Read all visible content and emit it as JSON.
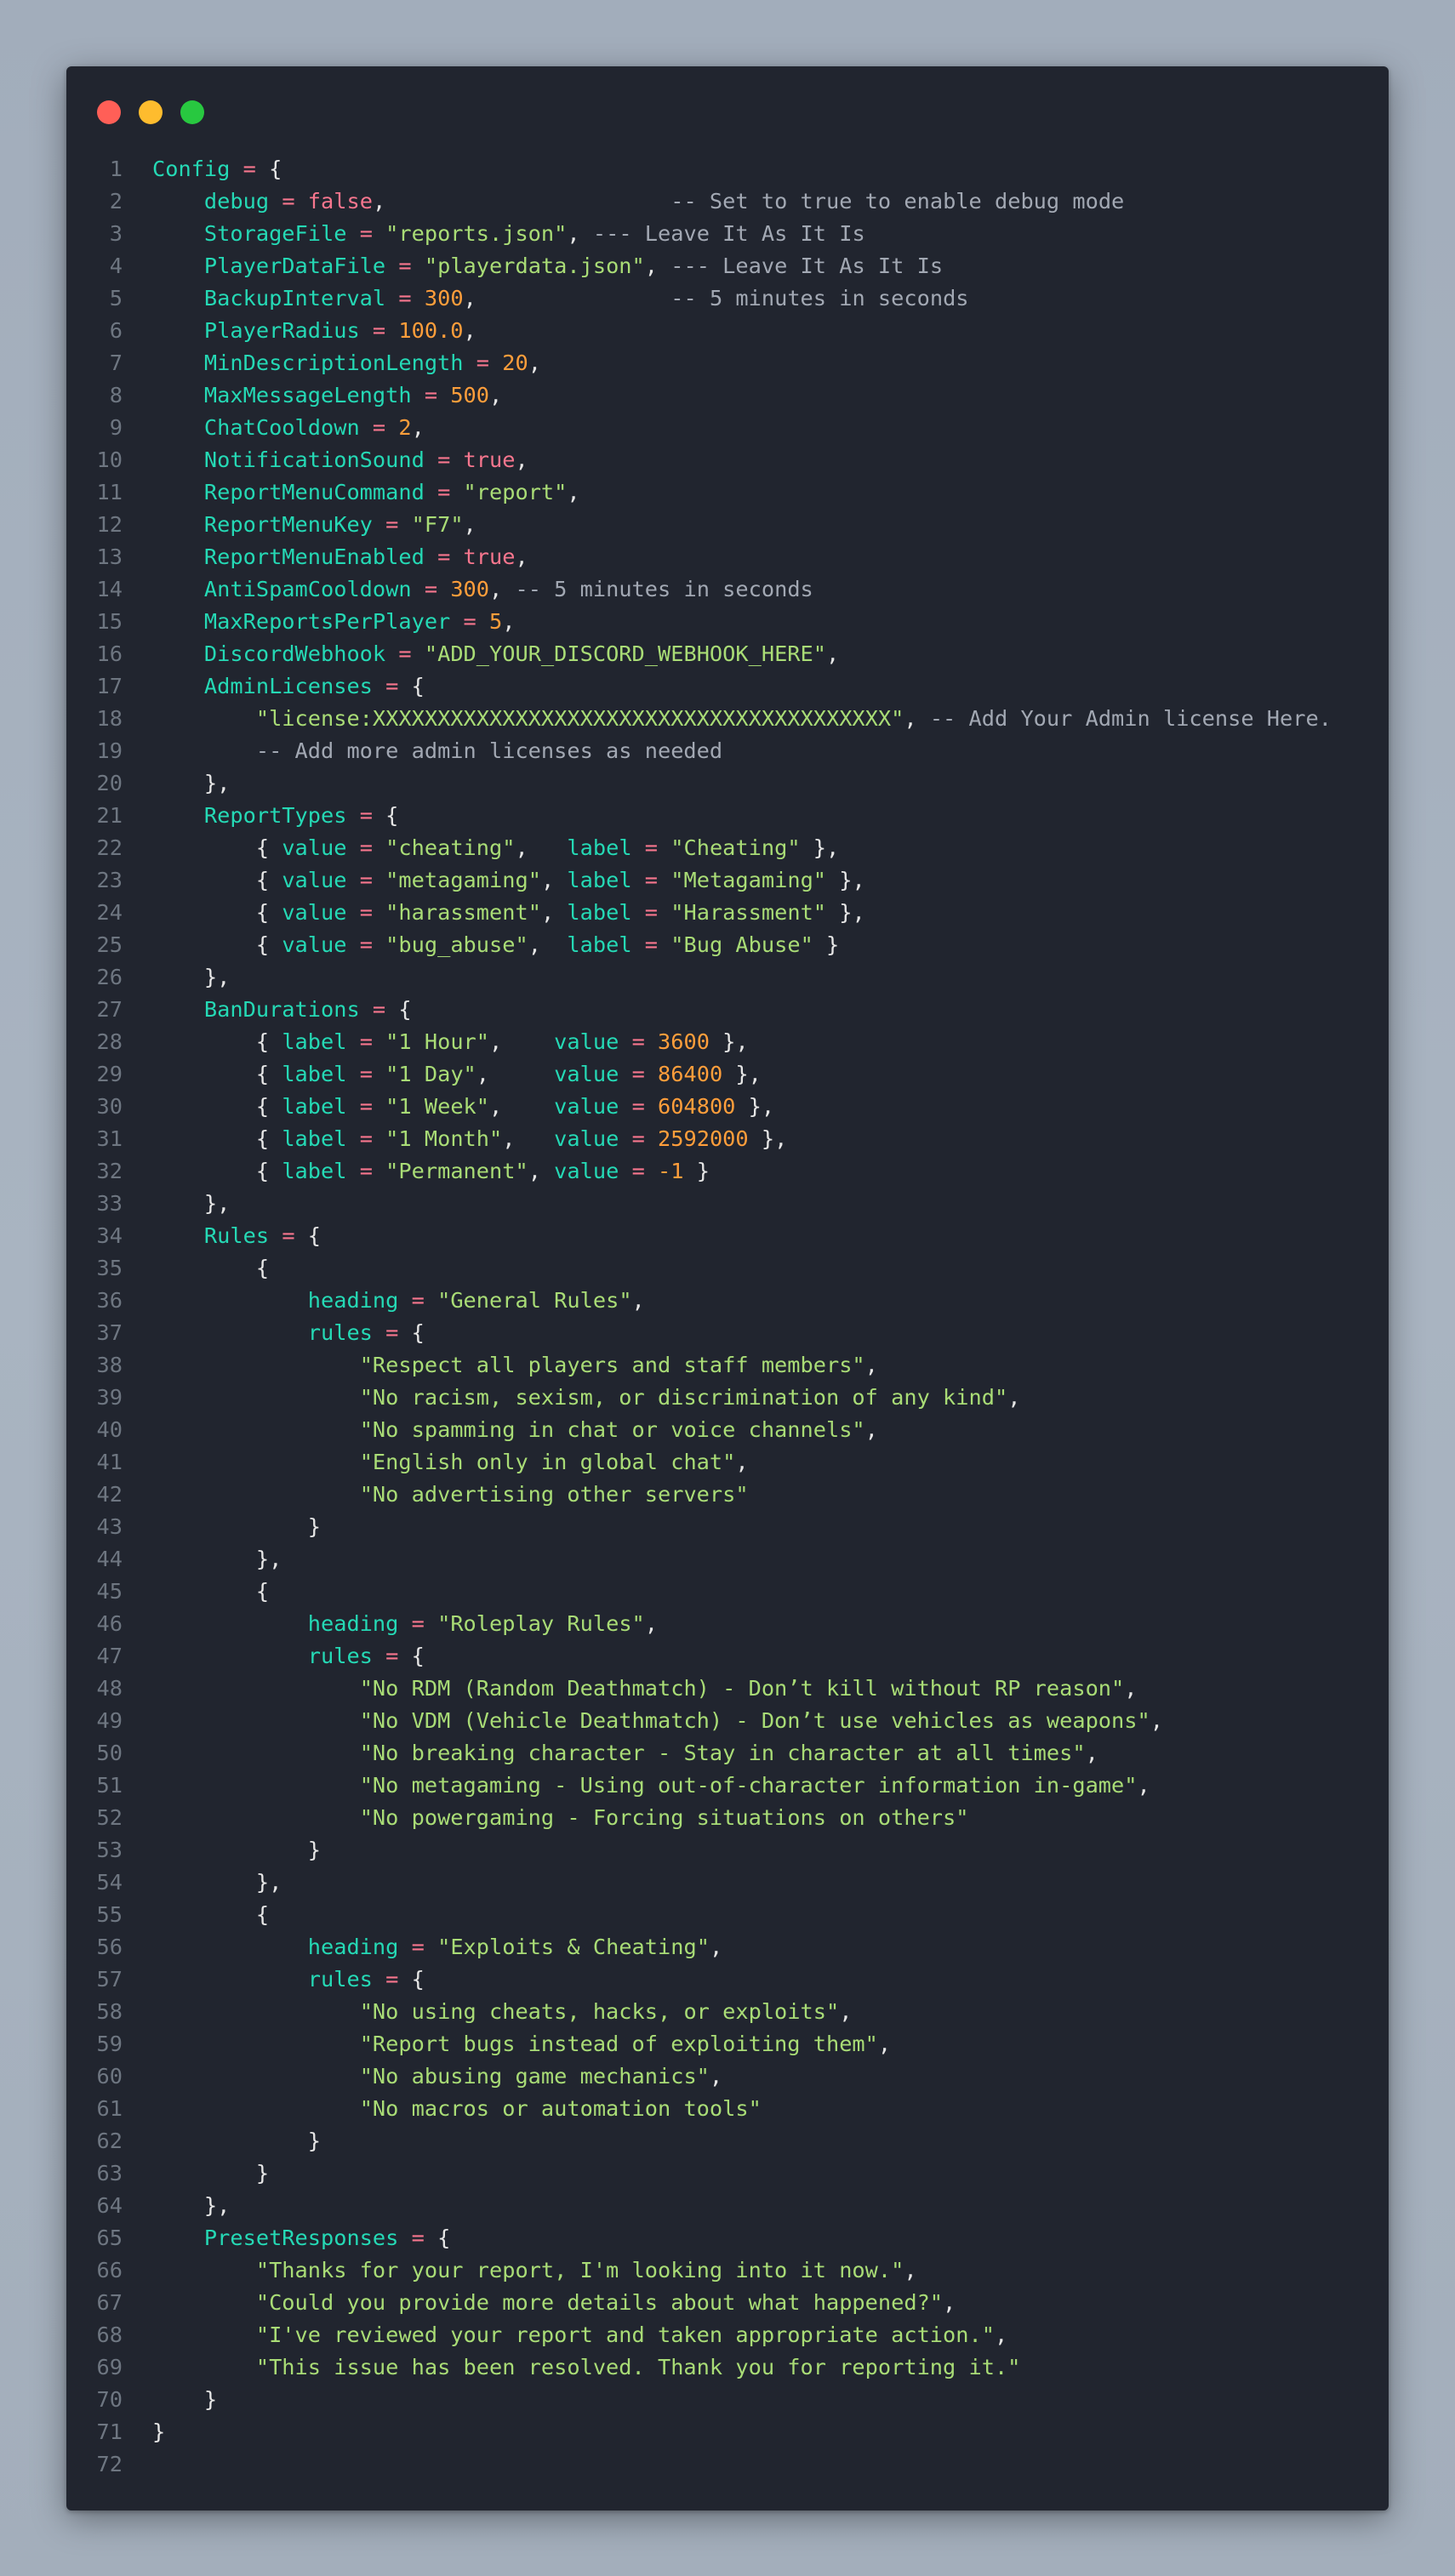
{
  "window": {
    "buttons": [
      "close",
      "minimize",
      "maximize"
    ]
  },
  "colors": {
    "identifier": "#25d9b5",
    "operator": "#f7768e",
    "boolean": "#f7768e",
    "string": "#a9dc76",
    "number": "#ff9e3b",
    "comment": "#a2a8b3",
    "punctuation": "#e6e6e6",
    "line_number": "#6e7681",
    "editor_background": "#21252f"
  },
  "code_lines": [
    [
      [
        "id",
        "Config"
      ],
      [
        "p",
        " "
      ],
      [
        "op",
        "="
      ],
      [
        "p",
        " {"
      ]
    ],
    [
      [
        "p",
        "    "
      ],
      [
        "id",
        "debug"
      ],
      [
        "p",
        " "
      ],
      [
        "op",
        "="
      ],
      [
        "p",
        " "
      ],
      [
        "bool",
        "false"
      ],
      [
        "p",
        ",                      "
      ],
      [
        "com",
        "-- Set to true to enable debug mode"
      ]
    ],
    [
      [
        "p",
        "    "
      ],
      [
        "id",
        "StorageFile"
      ],
      [
        "p",
        " "
      ],
      [
        "op",
        "="
      ],
      [
        "p",
        " "
      ],
      [
        "str",
        "\"reports.json\""
      ],
      [
        "p",
        ", "
      ],
      [
        "com",
        "--- Leave It As It Is"
      ]
    ],
    [
      [
        "p",
        "    "
      ],
      [
        "id",
        "PlayerDataFile"
      ],
      [
        "p",
        " "
      ],
      [
        "op",
        "="
      ],
      [
        "p",
        " "
      ],
      [
        "str",
        "\"playerdata.json\""
      ],
      [
        "p",
        ", "
      ],
      [
        "com",
        "--- Leave It As It Is"
      ]
    ],
    [
      [
        "p",
        "    "
      ],
      [
        "id",
        "BackupInterval"
      ],
      [
        "p",
        " "
      ],
      [
        "op",
        "="
      ],
      [
        "p",
        " "
      ],
      [
        "num",
        "300"
      ],
      [
        "p",
        ",               "
      ],
      [
        "com",
        "-- 5 minutes in seconds"
      ]
    ],
    [
      [
        "p",
        "    "
      ],
      [
        "id",
        "PlayerRadius"
      ],
      [
        "p",
        " "
      ],
      [
        "op",
        "="
      ],
      [
        "p",
        " "
      ],
      [
        "num",
        "100.0"
      ],
      [
        "p",
        ","
      ]
    ],
    [
      [
        "p",
        "    "
      ],
      [
        "id",
        "MinDescriptionLength"
      ],
      [
        "p",
        " "
      ],
      [
        "op",
        "="
      ],
      [
        "p",
        " "
      ],
      [
        "num",
        "20"
      ],
      [
        "p",
        ","
      ]
    ],
    [
      [
        "p",
        "    "
      ],
      [
        "id",
        "MaxMessageLength"
      ],
      [
        "p",
        " "
      ],
      [
        "op",
        "="
      ],
      [
        "p",
        " "
      ],
      [
        "num",
        "500"
      ],
      [
        "p",
        ","
      ]
    ],
    [
      [
        "p",
        "    "
      ],
      [
        "id",
        "ChatCooldown"
      ],
      [
        "p",
        " "
      ],
      [
        "op",
        "="
      ],
      [
        "p",
        " "
      ],
      [
        "num",
        "2"
      ],
      [
        "p",
        ","
      ]
    ],
    [
      [
        "p",
        "    "
      ],
      [
        "id",
        "NotificationSound"
      ],
      [
        "p",
        " "
      ],
      [
        "op",
        "="
      ],
      [
        "p",
        " "
      ],
      [
        "bool",
        "true"
      ],
      [
        "p",
        ","
      ]
    ],
    [
      [
        "p",
        "    "
      ],
      [
        "id",
        "ReportMenuCommand"
      ],
      [
        "p",
        " "
      ],
      [
        "op",
        "="
      ],
      [
        "p",
        " "
      ],
      [
        "str",
        "\"report\""
      ],
      [
        "p",
        ","
      ]
    ],
    [
      [
        "p",
        "    "
      ],
      [
        "id",
        "ReportMenuKey"
      ],
      [
        "p",
        " "
      ],
      [
        "op",
        "="
      ],
      [
        "p",
        " "
      ],
      [
        "str",
        "\"F7\""
      ],
      [
        "p",
        ","
      ]
    ],
    [
      [
        "p",
        "    "
      ],
      [
        "id",
        "ReportMenuEnabled"
      ],
      [
        "p",
        " "
      ],
      [
        "op",
        "="
      ],
      [
        "p",
        " "
      ],
      [
        "bool",
        "true"
      ],
      [
        "p",
        ","
      ]
    ],
    [
      [
        "p",
        "    "
      ],
      [
        "id",
        "AntiSpamCooldown"
      ],
      [
        "p",
        " "
      ],
      [
        "op",
        "="
      ],
      [
        "p",
        " "
      ],
      [
        "num",
        "300"
      ],
      [
        "p",
        ", "
      ],
      [
        "com",
        "-- 5 minutes in seconds"
      ]
    ],
    [
      [
        "p",
        "    "
      ],
      [
        "id",
        "MaxReportsPerPlayer"
      ],
      [
        "p",
        " "
      ],
      [
        "op",
        "="
      ],
      [
        "p",
        " "
      ],
      [
        "num",
        "5"
      ],
      [
        "p",
        ","
      ]
    ],
    [
      [
        "p",
        "    "
      ],
      [
        "id",
        "DiscordWebhook"
      ],
      [
        "p",
        " "
      ],
      [
        "op",
        "="
      ],
      [
        "p",
        " "
      ],
      [
        "str",
        "\"ADD_YOUR_DISCORD_WEBHOOK_HERE\""
      ],
      [
        "p",
        ","
      ]
    ],
    [
      [
        "p",
        "    "
      ],
      [
        "id",
        "AdminLicenses"
      ],
      [
        "p",
        " "
      ],
      [
        "op",
        "="
      ],
      [
        "p",
        " {"
      ]
    ],
    [
      [
        "p",
        "        "
      ],
      [
        "str",
        "\"license:XXXXXXXXXXXXXXXXXXXXXXXXXXXXXXXXXXXXXXXX\""
      ],
      [
        "p",
        ", "
      ],
      [
        "com",
        "-- Add Your Admin license Here."
      ]
    ],
    [
      [
        "p",
        "        "
      ],
      [
        "com",
        "-- Add more admin licenses as needed"
      ]
    ],
    [
      [
        "p",
        "    },"
      ]
    ],
    [
      [
        "p",
        "    "
      ],
      [
        "id",
        "ReportTypes"
      ],
      [
        "p",
        " "
      ],
      [
        "op",
        "="
      ],
      [
        "p",
        " {"
      ]
    ],
    [
      [
        "p",
        "        { "
      ],
      [
        "id",
        "value"
      ],
      [
        "p",
        " "
      ],
      [
        "op",
        "="
      ],
      [
        "p",
        " "
      ],
      [
        "str",
        "\"cheating\""
      ],
      [
        "p",
        ",   "
      ],
      [
        "id",
        "label"
      ],
      [
        "p",
        " "
      ],
      [
        "op",
        "="
      ],
      [
        "p",
        " "
      ],
      [
        "str",
        "\"Cheating\""
      ],
      [
        "p",
        " },"
      ]
    ],
    [
      [
        "p",
        "        { "
      ],
      [
        "id",
        "value"
      ],
      [
        "p",
        " "
      ],
      [
        "op",
        "="
      ],
      [
        "p",
        " "
      ],
      [
        "str",
        "\"metagaming\""
      ],
      [
        "p",
        ", "
      ],
      [
        "id",
        "label"
      ],
      [
        "p",
        " "
      ],
      [
        "op",
        "="
      ],
      [
        "p",
        " "
      ],
      [
        "str",
        "\"Metagaming\""
      ],
      [
        "p",
        " },"
      ]
    ],
    [
      [
        "p",
        "        { "
      ],
      [
        "id",
        "value"
      ],
      [
        "p",
        " "
      ],
      [
        "op",
        "="
      ],
      [
        "p",
        " "
      ],
      [
        "str",
        "\"harassment\""
      ],
      [
        "p",
        ", "
      ],
      [
        "id",
        "label"
      ],
      [
        "p",
        " "
      ],
      [
        "op",
        "="
      ],
      [
        "p",
        " "
      ],
      [
        "str",
        "\"Harassment\""
      ],
      [
        "p",
        " },"
      ]
    ],
    [
      [
        "p",
        "        { "
      ],
      [
        "id",
        "value"
      ],
      [
        "p",
        " "
      ],
      [
        "op",
        "="
      ],
      [
        "p",
        " "
      ],
      [
        "str",
        "\"bug_abuse\""
      ],
      [
        "p",
        ",  "
      ],
      [
        "id",
        "label"
      ],
      [
        "p",
        " "
      ],
      [
        "op",
        "="
      ],
      [
        "p",
        " "
      ],
      [
        "str",
        "\"Bug Abuse\""
      ],
      [
        "p",
        " }"
      ]
    ],
    [
      [
        "p",
        "    },"
      ]
    ],
    [
      [
        "p",
        "    "
      ],
      [
        "id",
        "BanDurations"
      ],
      [
        "p",
        " "
      ],
      [
        "op",
        "="
      ],
      [
        "p",
        " {"
      ]
    ],
    [
      [
        "p",
        "        { "
      ],
      [
        "id",
        "label"
      ],
      [
        "p",
        " "
      ],
      [
        "op",
        "="
      ],
      [
        "p",
        " "
      ],
      [
        "str",
        "\"1 Hour\""
      ],
      [
        "p",
        ",    "
      ],
      [
        "id",
        "value"
      ],
      [
        "p",
        " "
      ],
      [
        "op",
        "="
      ],
      [
        "p",
        " "
      ],
      [
        "num",
        "3600"
      ],
      [
        "p",
        " },"
      ]
    ],
    [
      [
        "p",
        "        { "
      ],
      [
        "id",
        "label"
      ],
      [
        "p",
        " "
      ],
      [
        "op",
        "="
      ],
      [
        "p",
        " "
      ],
      [
        "str",
        "\"1 Day\""
      ],
      [
        "p",
        ",     "
      ],
      [
        "id",
        "value"
      ],
      [
        "p",
        " "
      ],
      [
        "op",
        "="
      ],
      [
        "p",
        " "
      ],
      [
        "num",
        "86400"
      ],
      [
        "p",
        " },"
      ]
    ],
    [
      [
        "p",
        "        { "
      ],
      [
        "id",
        "label"
      ],
      [
        "p",
        " "
      ],
      [
        "op",
        "="
      ],
      [
        "p",
        " "
      ],
      [
        "str",
        "\"1 Week\""
      ],
      [
        "p",
        ",    "
      ],
      [
        "id",
        "value"
      ],
      [
        "p",
        " "
      ],
      [
        "op",
        "="
      ],
      [
        "p",
        " "
      ],
      [
        "num",
        "604800"
      ],
      [
        "p",
        " },"
      ]
    ],
    [
      [
        "p",
        "        { "
      ],
      [
        "id",
        "label"
      ],
      [
        "p",
        " "
      ],
      [
        "op",
        "="
      ],
      [
        "p",
        " "
      ],
      [
        "str",
        "\"1 Month\""
      ],
      [
        "p",
        ",   "
      ],
      [
        "id",
        "value"
      ],
      [
        "p",
        " "
      ],
      [
        "op",
        "="
      ],
      [
        "p",
        " "
      ],
      [
        "num",
        "2592000"
      ],
      [
        "p",
        " },"
      ]
    ],
    [
      [
        "p",
        "        { "
      ],
      [
        "id",
        "label"
      ],
      [
        "p",
        " "
      ],
      [
        "op",
        "="
      ],
      [
        "p",
        " "
      ],
      [
        "str",
        "\"Permanent\""
      ],
      [
        "p",
        ", "
      ],
      [
        "id",
        "value"
      ],
      [
        "p",
        " "
      ],
      [
        "op",
        "="
      ],
      [
        "p",
        " "
      ],
      [
        "num",
        "-1"
      ],
      [
        "p",
        " }"
      ]
    ],
    [
      [
        "p",
        "    },"
      ]
    ],
    [
      [
        "p",
        "    "
      ],
      [
        "id",
        "Rules"
      ],
      [
        "p",
        " "
      ],
      [
        "op",
        "="
      ],
      [
        "p",
        " {"
      ]
    ],
    [
      [
        "p",
        "        {"
      ]
    ],
    [
      [
        "p",
        "            "
      ],
      [
        "id",
        "heading"
      ],
      [
        "p",
        " "
      ],
      [
        "op",
        "="
      ],
      [
        "p",
        " "
      ],
      [
        "str",
        "\"General Rules\""
      ],
      [
        "p",
        ","
      ]
    ],
    [
      [
        "p",
        "            "
      ],
      [
        "id",
        "rules"
      ],
      [
        "p",
        " "
      ],
      [
        "op",
        "="
      ],
      [
        "p",
        " {"
      ]
    ],
    [
      [
        "p",
        "                "
      ],
      [
        "str",
        "\"Respect all players and staff members\""
      ],
      [
        "p",
        ","
      ]
    ],
    [
      [
        "p",
        "                "
      ],
      [
        "str",
        "\"No racism, sexism, or discrimination of any kind\""
      ],
      [
        "p",
        ","
      ]
    ],
    [
      [
        "p",
        "                "
      ],
      [
        "str",
        "\"No spamming in chat or voice channels\""
      ],
      [
        "p",
        ","
      ]
    ],
    [
      [
        "p",
        "                "
      ],
      [
        "str",
        "\"English only in global chat\""
      ],
      [
        "p",
        ","
      ]
    ],
    [
      [
        "p",
        "                "
      ],
      [
        "str",
        "\"No advertising other servers\""
      ]
    ],
    [
      [
        "p",
        "            }"
      ]
    ],
    [
      [
        "p",
        "        },"
      ]
    ],
    [
      [
        "p",
        "        {"
      ]
    ],
    [
      [
        "p",
        "            "
      ],
      [
        "id",
        "heading"
      ],
      [
        "p",
        " "
      ],
      [
        "op",
        "="
      ],
      [
        "p",
        " "
      ],
      [
        "str",
        "\"Roleplay Rules\""
      ],
      [
        "p",
        ","
      ]
    ],
    [
      [
        "p",
        "            "
      ],
      [
        "id",
        "rules"
      ],
      [
        "p",
        " "
      ],
      [
        "op",
        "="
      ],
      [
        "p",
        " {"
      ]
    ],
    [
      [
        "p",
        "                "
      ],
      [
        "str",
        "\"No RDM (Random Deathmatch) - Don’t kill without RP reason\""
      ],
      [
        "p",
        ","
      ]
    ],
    [
      [
        "p",
        "                "
      ],
      [
        "str",
        "\"No VDM (Vehicle Deathmatch) - Don’t use vehicles as weapons\""
      ],
      [
        "p",
        ","
      ]
    ],
    [
      [
        "p",
        "                "
      ],
      [
        "str",
        "\"No breaking character - Stay in character at all times\""
      ],
      [
        "p",
        ","
      ]
    ],
    [
      [
        "p",
        "                "
      ],
      [
        "str",
        "\"No metagaming - Using out-of-character information in-game\""
      ],
      [
        "p",
        ","
      ]
    ],
    [
      [
        "p",
        "                "
      ],
      [
        "str",
        "\"No powergaming - Forcing situations on others\""
      ]
    ],
    [
      [
        "p",
        "            }"
      ]
    ],
    [
      [
        "p",
        "        },"
      ]
    ],
    [
      [
        "p",
        "        {"
      ]
    ],
    [
      [
        "p",
        "            "
      ],
      [
        "id",
        "heading"
      ],
      [
        "p",
        " "
      ],
      [
        "op",
        "="
      ],
      [
        "p",
        " "
      ],
      [
        "str",
        "\"Exploits & Cheating\""
      ],
      [
        "p",
        ","
      ]
    ],
    [
      [
        "p",
        "            "
      ],
      [
        "id",
        "rules"
      ],
      [
        "p",
        " "
      ],
      [
        "op",
        "="
      ],
      [
        "p",
        " {"
      ]
    ],
    [
      [
        "p",
        "                "
      ],
      [
        "str",
        "\"No using cheats, hacks, or exploits\""
      ],
      [
        "p",
        ","
      ]
    ],
    [
      [
        "p",
        "                "
      ],
      [
        "str",
        "\"Report bugs instead of exploiting them\""
      ],
      [
        "p",
        ","
      ]
    ],
    [
      [
        "p",
        "                "
      ],
      [
        "str",
        "\"No abusing game mechanics\""
      ],
      [
        "p",
        ","
      ]
    ],
    [
      [
        "p",
        "                "
      ],
      [
        "str",
        "\"No macros or automation tools\""
      ]
    ],
    [
      [
        "p",
        "            }"
      ]
    ],
    [
      [
        "p",
        "        }"
      ]
    ],
    [
      [
        "p",
        "    },"
      ]
    ],
    [
      [
        "p",
        "    "
      ],
      [
        "id",
        "PresetResponses"
      ],
      [
        "p",
        " "
      ],
      [
        "op",
        "="
      ],
      [
        "p",
        " {"
      ]
    ],
    [
      [
        "p",
        "        "
      ],
      [
        "str",
        "\"Thanks for your report, I'm looking into it now.\""
      ],
      [
        "p",
        ","
      ]
    ],
    [
      [
        "p",
        "        "
      ],
      [
        "str",
        "\"Could you provide more details about what happened?\""
      ],
      [
        "p",
        ","
      ]
    ],
    [
      [
        "p",
        "        "
      ],
      [
        "str",
        "\"I've reviewed your report and taken appropriate action.\""
      ],
      [
        "p",
        ","
      ]
    ],
    [
      [
        "p",
        "        "
      ],
      [
        "str",
        "\"This issue has been resolved. Thank you for reporting it.\""
      ]
    ],
    [
      [
        "p",
        "    }"
      ]
    ],
    [
      [
        "p",
        "}"
      ]
    ],
    []
  ]
}
